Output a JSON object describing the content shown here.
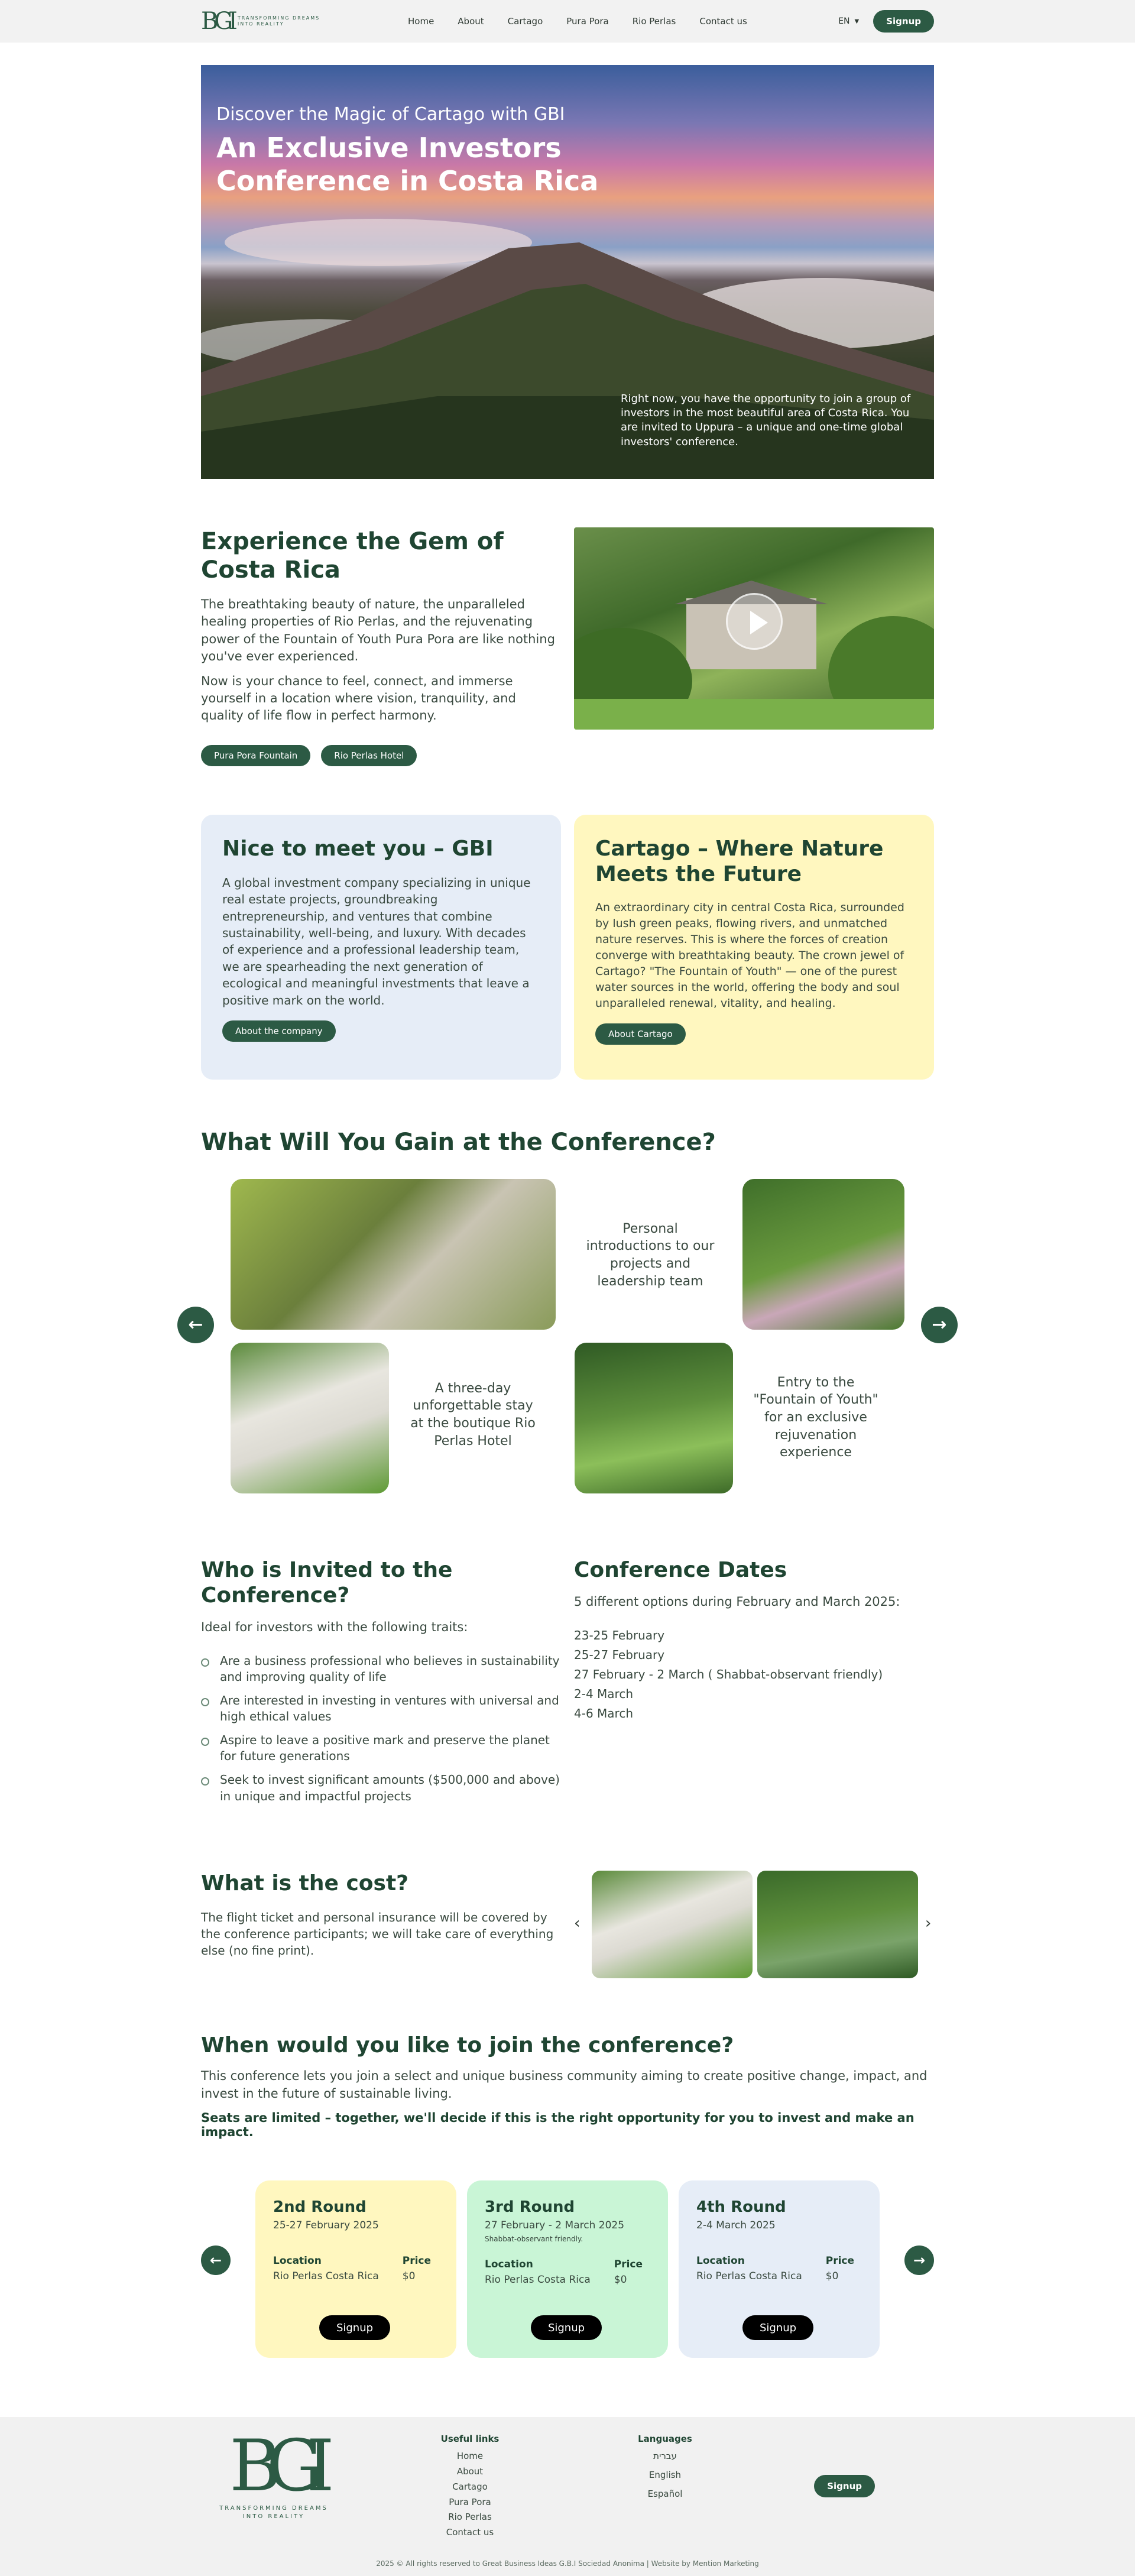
{
  "nav": {
    "logo_mark": "BGI",
    "logo_tagline": [
      "Transforming Dreams",
      "Into Reality"
    ],
    "menu": [
      "Home",
      "About",
      "Cartago",
      "Pura Pora",
      "Rio Perlas",
      "Contact us"
    ],
    "lang": "EN",
    "signup": "Signup"
  },
  "hero": {
    "kicker": "Discover the Magic of Cartago with GBI",
    "title": "An Exclusive Investors Conference in Costa Rica",
    "text": "Right now, you have the opportunity to join a group of investors in the most beautiful area of Costa Rica. You are invited to Uppura – a unique and one-time global investors' conference."
  },
  "gem": {
    "title": "Experience the Gem of Costa Rica",
    "p1": "The breathtaking beauty of nature, the unparalleled healing properties of Rio Perlas, and the rejuvenating power of the Fountain of Youth Pura Pora are like nothing you've ever experienced.",
    "p2": "Now is your chance to feel, connect, and immerse yourself in a location where vision, tranquility, and quality of life flow in perfect harmony.",
    "chip1": "Pura Pora Fountain",
    "chip2": "Rio Perlas Hotel"
  },
  "about": {
    "title": "Nice to meet you – GBI",
    "text": "A global investment company specializing in unique real estate projects, groundbreaking entrepreneurship, and ventures that combine sustainability, well-being, and luxury. With decades of experience and a professional leadership team, we are spearheading the next generation of ecological and meaningful investments that leave a positive mark on the world.",
    "button": "About the company"
  },
  "cartago": {
    "title": "Cartago – Where Nature Meets the Future",
    "text": "An extraordinary city in central Costa Rica, surrounded by lush green peaks, flowing rivers, and unmatched nature reserves. This is where the forces of creation converge with breathtaking beauty. The crown jewel of Cartago? \"The Fountain of Youth\" — one of the purest water sources in the world, offering the body and soul unparalleled renewal, vitality, and healing.",
    "button": "About Cartago"
  },
  "gain": {
    "title": "What Will You Gain at the Conference?",
    "t1": "Personal introductions to our projects and leadership team",
    "t2": "A three-day unforgettable stay at the boutique Rio Perlas Hotel",
    "t3": "Entry to the \"Fountain of Youth\" for an exclusive rejuvenation experience",
    "prev": "←",
    "next": "→"
  },
  "invited": {
    "title": "Who is Invited to the Conference?",
    "intro": "Ideal for investors with the following traits:",
    "traits": [
      "Are a business professional who believes in sustainability and improving quality of life",
      "Are interested in investing in ventures with universal and high ethical values",
      "Aspire to leave a positive mark and preserve the planet for future generations",
      "Seek to invest significant amounts ($500,000 and above) in unique and impactful projects"
    ]
  },
  "dates": {
    "title": "Conference Dates",
    "intro": "5 different options during February and March 2025:",
    "items": [
      "23-25 February",
      "25-27 February",
      "27 February - 2 March ( Shabbat-observant friendly)",
      "2-4 March",
      "4-6 March"
    ]
  },
  "cost": {
    "title": "What is the cost?",
    "text": "The flight ticket and personal insurance will be covered by the conference participants; we will take care of everything else (no fine print).",
    "prev": "‹",
    "next": "›"
  },
  "join": {
    "title": "When would you like to join the conference?",
    "text": "This conference lets you join a select and unique business community aiming to create positive change, impact, and invest in the future of sustainable living.",
    "strong": "Seats are limited – together, we'll decide if this is the right opportunity for you to invest and make an impact.",
    "prev": "←",
    "next": "→",
    "rounds": [
      {
        "title": "2nd Round",
        "dates": "25-27 February 2025",
        "note": "",
        "loc_label": "Location",
        "loc": "Rio Perlas Costa Rica",
        "price_label": "Price",
        "price": "$0",
        "button": "Signup",
        "color": "#fff7bf"
      },
      {
        "title": "3rd Round",
        "dates": "27 February - 2 March 2025",
        "note": "Shabbat-observant friendly.",
        "loc_label": "Location",
        "loc": "Rio Perlas Costa Rica",
        "price_label": "Price",
        "price": "$0",
        "button": "Signup",
        "color": "#c9f5d6"
      },
      {
        "title": "4th Round",
        "dates": "2-4 March 2025",
        "note": "",
        "loc_label": "Location",
        "loc": "Rio Perlas Costa Rica",
        "price_label": "Price",
        "price": "$0",
        "button": "Signup",
        "color": "#e6edf7"
      }
    ]
  },
  "footer": {
    "logo_mark": "BGI",
    "logo_tagline": [
      "Transforming Dreams",
      "Into Reality"
    ],
    "links_title": "Useful links",
    "links": [
      "Home",
      "About",
      "Cartago",
      "Pura Pora",
      "Rio Perlas",
      "Contact us"
    ],
    "langs_title": "Languages",
    "langs": [
      "עברית",
      "English",
      "Español"
    ],
    "signup": "Signup",
    "copyright": "2025 © All rights reserved to Great Business Ideas G.B.I Sociedad Anonima | Website by Mention Marketing"
  },
  "colors": {
    "brand_green": "#2c5a44",
    "heading_green": "#1f4532",
    "card_blue": "#e6edf7",
    "card_yellow": "#fff7bf",
    "card_mint": "#c9f5d6"
  }
}
